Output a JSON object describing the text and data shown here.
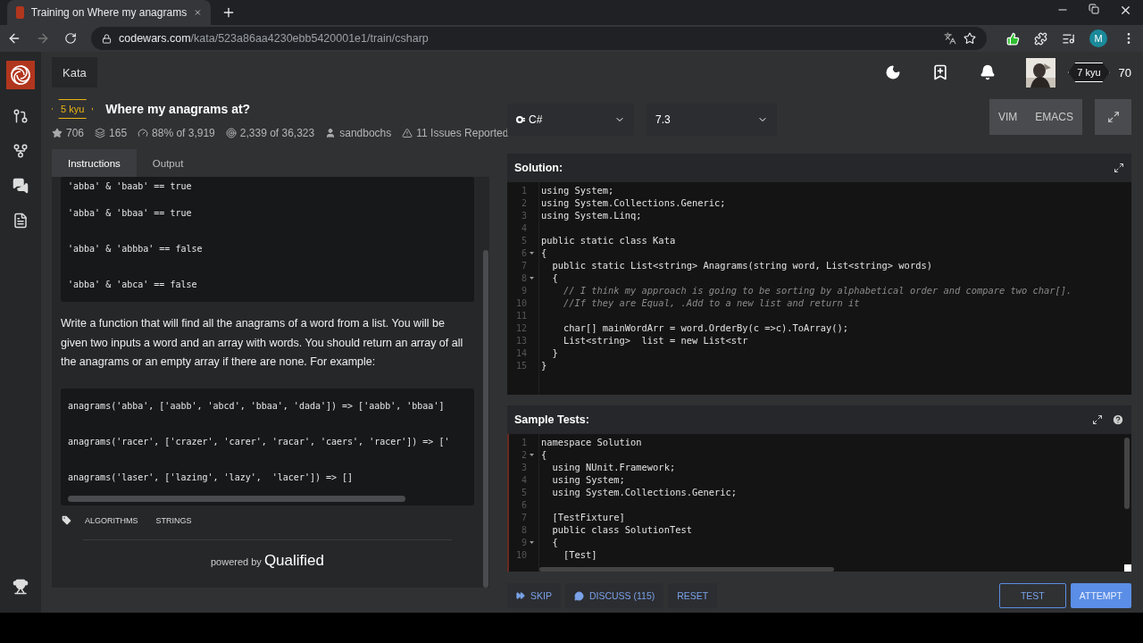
{
  "browser": {
    "tab_title": "Training on Where my anagrams",
    "url_domain": "codewars.com",
    "url_path": "/kata/523a86aa4230ebb5420001e1/train/csharp",
    "profile_letter": "M"
  },
  "nav": {
    "section": "Kata"
  },
  "user": {
    "rank": "7 kyu",
    "honor": "70"
  },
  "kata": {
    "rank": "5 kyu",
    "title": "Where my anagrams at?",
    "stats": [
      {
        "kind": "star",
        "text": "706"
      },
      {
        "kind": "stack",
        "text": "165"
      },
      {
        "kind": "gauge",
        "text": "88% of 3,919"
      },
      {
        "kind": "target",
        "text": "2,339 of 36,323"
      },
      {
        "kind": "user",
        "text": "sandbochs"
      },
      {
        "kind": "warning",
        "text": "11 Issues Reported"
      }
    ]
  },
  "left_tabs": [
    {
      "label": "Instructions",
      "selected": true
    },
    {
      "label": "Output",
      "selected": false
    }
  ],
  "instructions": {
    "compare_examples": [
      "'abba' & 'baab' == true",
      "'abba' & 'bbaa' == true",
      "'abba' & 'abbba' == false",
      "'abba' & 'abca' == false"
    ],
    "description": "Write a function that will find all the anagrams of a word from a list. You will be given two inputs a word and an array with words. You should return an array of all the anagrams or an empty array if there are none. For example:",
    "code_examples": [
      "anagrams('abba', ['aabb', 'abcd', 'bbaa', 'dada']) => ['aabb', 'bbaa']",
      "anagrams('racer', ['crazer', 'carer', 'racar', 'caers', 'racer']) => ['",
      "anagrams('laser', ['lazing', 'lazy',  'lacer']) => []"
    ],
    "tags": [
      "ALGORITHMS",
      "STRINGS"
    ],
    "powered_by": "powered by",
    "brand": "Qualified"
  },
  "toolbar": {
    "language": "C#",
    "version": "7.3",
    "modes": [
      "VIM",
      "EMACS"
    ]
  },
  "solution": {
    "title": "Solution:",
    "lines": [
      {
        "n": "1",
        "text": "using System;",
        "kind": "code",
        "fold": false
      },
      {
        "n": "2",
        "text": "using System.Collections.Generic;",
        "kind": "code",
        "fold": false
      },
      {
        "n": "3",
        "text": "using System.Linq;",
        "kind": "code",
        "fold": false
      },
      {
        "n": "4",
        "fold": false
      },
      {
        "n": "5",
        "text": "public static class Kata",
        "kind": "code",
        "fold": false
      },
      {
        "n": "6",
        "text": "{",
        "kind": "code",
        "fold": true
      },
      {
        "n": "7",
        "text": "  public static List<string> Anagrams(string word, List<string> words)",
        "kind": "code",
        "fold": false
      },
      {
        "n": "8",
        "text": "  {",
        "kind": "code",
        "fold": true
      },
      {
        "n": "9",
        "text": "    // I think my approach is going to be sorting by alphabetical order and compare two char[].",
        "kind": "comment",
        "fold": false
      },
      {
        "n": "10",
        "text": "    //If they are Equal, .Add to a new list and return it",
        "kind": "comment",
        "fold": false
      },
      {
        "n": "11",
        "fold": false
      },
      {
        "n": "12",
        "text": "    char[] mainWordArr = word.OrderBy(c =>c).ToArray();",
        "kind": "code",
        "fold": false
      },
      {
        "n": "13",
        "text": "    List<string>  list = new List<str",
        "kind": "code",
        "fold": false
      },
      {
        "n": "14",
        "text": "  }",
        "kind": "code",
        "fold": false
      },
      {
        "n": "15",
        "text": "}",
        "kind": "code",
        "fold": false
      }
    ]
  },
  "tests": {
    "title": "Sample Tests:",
    "lines": [
      {
        "n": "1",
        "text": "namespace Solution",
        "kind": "code",
        "fold": false
      },
      {
        "n": "2",
        "text": "{",
        "kind": "code",
        "fold": true
      },
      {
        "n": "3",
        "text": "  using NUnit.Framework;",
        "kind": "code",
        "fold": false
      },
      {
        "n": "4",
        "text": "  using System;",
        "kind": "code",
        "fold": false
      },
      {
        "n": "5",
        "text": "  using System.Collections.Generic;",
        "kind": "code",
        "fold": false
      },
      {
        "n": "6",
        "fold": false
      },
      {
        "n": "7",
        "text": "  [TestFixture]",
        "kind": "code",
        "fold": false
      },
      {
        "n": "8",
        "text": "  public class SolutionTest",
        "kind": "code",
        "fold": false
      },
      {
        "n": "9",
        "text": "  {",
        "kind": "code",
        "fold": true
      },
      {
        "n": "10",
        "text": "    [Test]",
        "kind": "code",
        "fold": false
      }
    ]
  },
  "actions_left": [
    {
      "kind": "skip",
      "label": "SKIP"
    },
    {
      "kind": "discuss",
      "label": "DISCUSS (115)"
    },
    {
      "kind": "plain",
      "label": "RESET"
    }
  ],
  "actions_right": [
    {
      "kind": "outline",
      "label": "TEST"
    },
    {
      "kind": "primary",
      "label": "ATTEMPT"
    }
  ]
}
